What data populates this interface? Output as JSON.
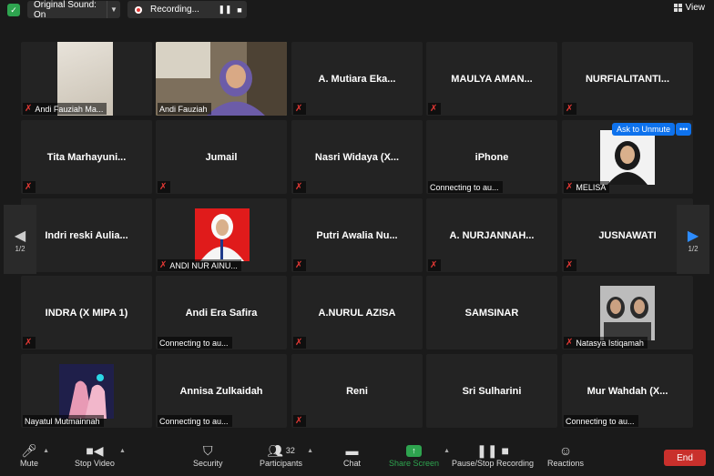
{
  "topbar": {
    "sound_label": "Original Sound: On",
    "recording_label": "Recording...",
    "pause_icon": "❚❚",
    "stop_icon": "■",
    "view_label": "View"
  },
  "tiles": [
    {
      "label": "Andi Fauziah Ma...",
      "muted": true,
      "photo": "paper"
    },
    {
      "label": "Andi Fauziah",
      "muted": false,
      "photo": "video",
      "active": true
    },
    {
      "name": "A. Mutiara Eka...",
      "muted": true
    },
    {
      "name": "MAULYA AMAN...",
      "muted": true
    },
    {
      "name": "NURFIALITANTI...",
      "muted": true
    },
    {
      "name": "Tita  Marhayuni...",
      "muted": true
    },
    {
      "name": "Jumail",
      "muted": true
    },
    {
      "name": "Nasri Widaya (X...",
      "muted": true
    },
    {
      "name": "iPhone",
      "label": "Connecting to au...",
      "muted": false
    },
    {
      "label": "MELISA",
      "muted": true,
      "photo": "hijab"
    },
    {
      "name": "Indri reski Aulia...",
      "muted": true
    },
    {
      "label": "ANDI NUR AINU...",
      "muted": true,
      "photo": "redportrait"
    },
    {
      "name": "Putri Awalia Nu...",
      "muted": true
    },
    {
      "name": "A. NURJANNAH...",
      "muted": true
    },
    {
      "name": "JUSNAWATI",
      "muted": true
    },
    {
      "name": "INDRA (X MIPA 1)",
      "muted": true
    },
    {
      "name": "Andi Era Safira",
      "label": "Connecting to au...",
      "muted": false
    },
    {
      "name": "A.NURUL AZISA",
      "muted": true
    },
    {
      "name": "SAMSINAR",
      "muted": false
    },
    {
      "label": "Natasya Istiqamah",
      "muted": true,
      "photo": "duo"
    },
    {
      "label": "Nayatul Mutmainnah",
      "muted": false,
      "photo": "pink"
    },
    {
      "name": "Annisa Zulkaidah",
      "label": "Connecting to au...",
      "muted": false
    },
    {
      "name": "Reni",
      "muted": true
    },
    {
      "name": "Sri Sulharini",
      "muted": false
    },
    {
      "name": "Mur Wahdah (X...",
      "label": "Connecting to au...",
      "muted": false
    }
  ],
  "pager": {
    "left": "1/2",
    "right": "1/2"
  },
  "unmute_button": "Ask to Unmute",
  "more_button": "•••",
  "toolbar": {
    "mute": "Mute",
    "stop_video": "Stop Video",
    "security": "Security",
    "participants": "Participants",
    "participants_count": "32",
    "chat": "Chat",
    "share_screen": "Share Screen",
    "pause_stop": "Pause/Stop Recording",
    "reactions": "Reactions",
    "end": "End"
  },
  "colors": {
    "accent": "#0e72ed",
    "active_border": "#c9e265",
    "share_green": "#2ea44f",
    "end_red": "#c9302c"
  }
}
